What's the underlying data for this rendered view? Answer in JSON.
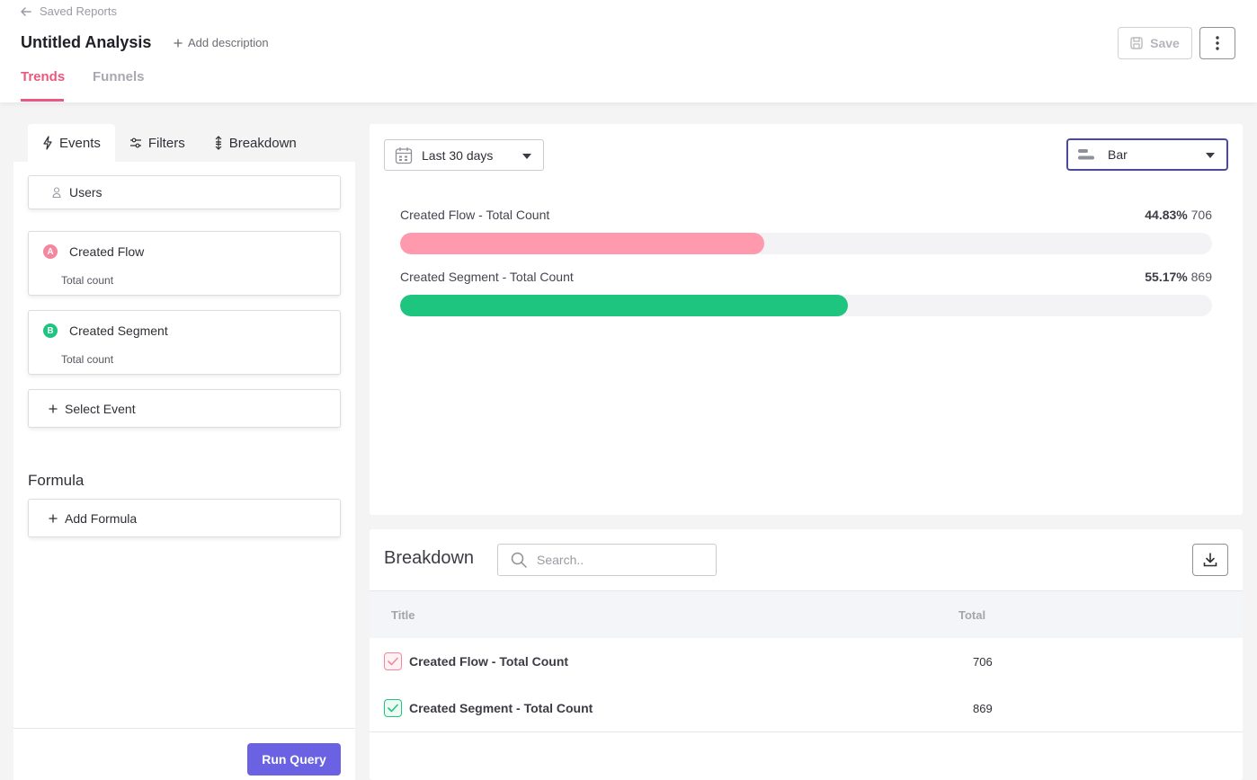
{
  "header": {
    "back_label": "Saved Reports",
    "title": "Untitled Analysis",
    "add_description": "Add description",
    "save_label": "Save",
    "tabs": [
      {
        "label": "Trends",
        "active": true
      },
      {
        "label": "Funnels",
        "active": false
      }
    ]
  },
  "sidebar": {
    "tabs": [
      {
        "label": "Events",
        "icon": "lightning-icon",
        "active": true
      },
      {
        "label": "Filters",
        "icon": "sliders-icon",
        "active": false
      },
      {
        "label": "Breakdown",
        "icon": "breakdown-icon",
        "active": false
      }
    ],
    "users_label": "Users",
    "events": [
      {
        "letter": "A",
        "name": "Created Flow",
        "metric": "Total count",
        "color": "#f4879f"
      },
      {
        "letter": "B",
        "name": "Created Segment",
        "metric": "Total count",
        "color": "#1dc57f"
      }
    ],
    "select_event_label": "Select Event",
    "formula_heading": "Formula",
    "add_formula_label": "Add Formula",
    "run_query_label": "Run Query"
  },
  "chart_controls": {
    "date_range": "Last 30 days",
    "chart_type": "Bar"
  },
  "chart_data": {
    "type": "bar",
    "categories": [
      "Created Flow - Total Count",
      "Created Segment - Total Count"
    ],
    "values": [
      706,
      869
    ],
    "percents": [
      "44.83%",
      "55.17%"
    ],
    "fractions": [
      0.4483,
      0.5517
    ],
    "colors": [
      "#ff9aae",
      "#1dc57f"
    ]
  },
  "breakdown": {
    "title": "Breakdown",
    "search_placeholder": "Search..",
    "columns": [
      "Title",
      "Total"
    ],
    "rows": [
      {
        "title": "Created Flow - Total Count",
        "total": "706",
        "checked": true,
        "color": "#f4879f"
      },
      {
        "title": "Created Segment - Total Count",
        "total": "869",
        "checked": true,
        "color": "#1dc57f"
      }
    ]
  }
}
